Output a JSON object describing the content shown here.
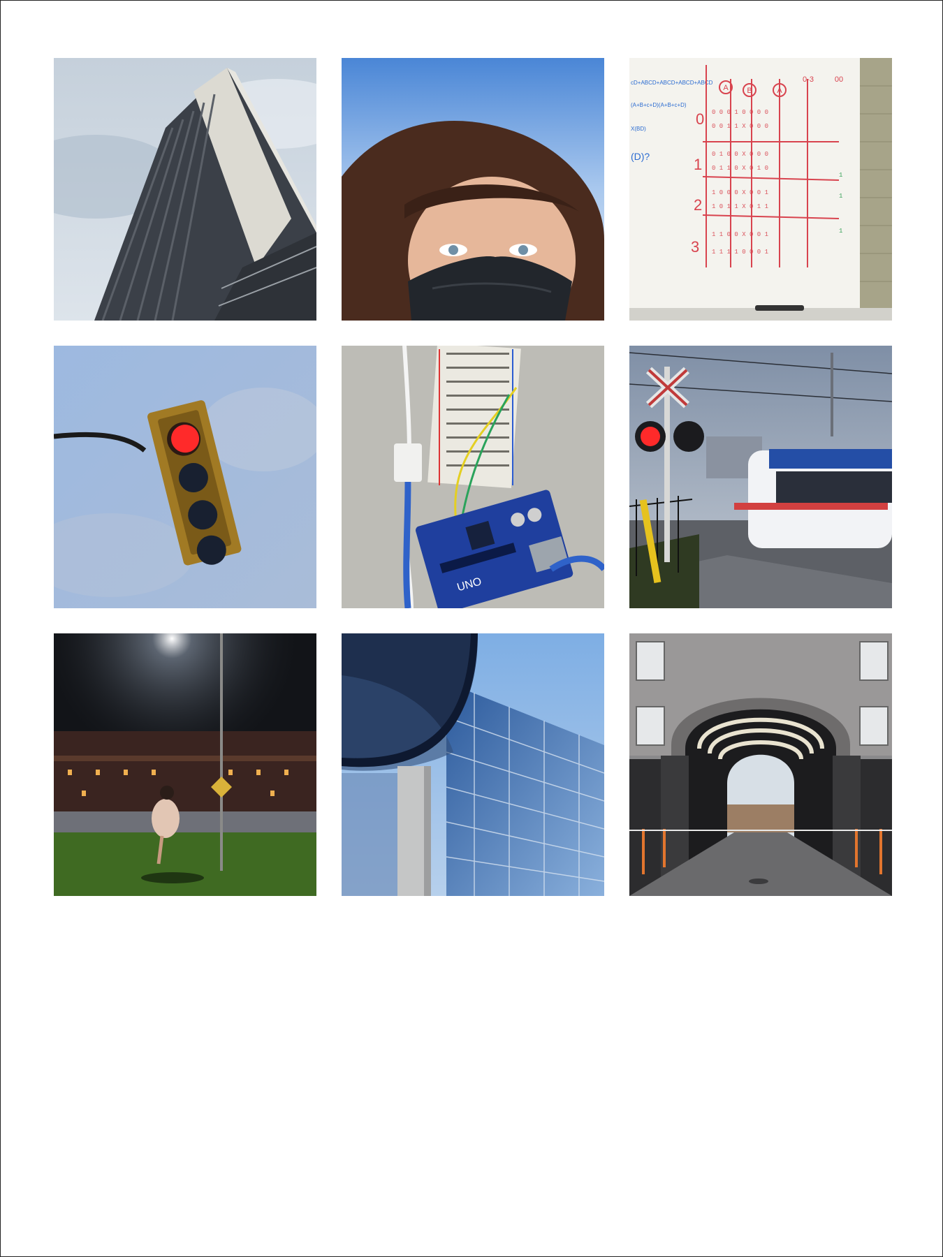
{
  "photos": [
    {
      "subject": "high-rise-building"
    },
    {
      "subject": "masked-selfie"
    },
    {
      "subject": "whiteboard-truth-table"
    },
    {
      "subject": "traffic-light"
    },
    {
      "subject": "arduino-breadboard"
    },
    {
      "subject": "light-rail-crossing"
    },
    {
      "subject": "night-street-lamp"
    },
    {
      "subject": "glass-building"
    },
    {
      "subject": "brick-archway"
    }
  ],
  "whiteboard": {
    "columns": [
      "A",
      "B",
      "A",
      "0-3",
      "00"
    ],
    "rows": [
      "0",
      "1",
      "2",
      "3"
    ],
    "notes": [
      "(D)?"
    ]
  },
  "board": {
    "chip_label": "UNO"
  },
  "colors": {
    "border": "#222222",
    "sky": "#b7c7d8",
    "marker_red": "#d8434e",
    "marker_blue": "#2a6bd1",
    "arduino_blue": "#1f3f9e",
    "signal_red": "#ff2a2a"
  }
}
